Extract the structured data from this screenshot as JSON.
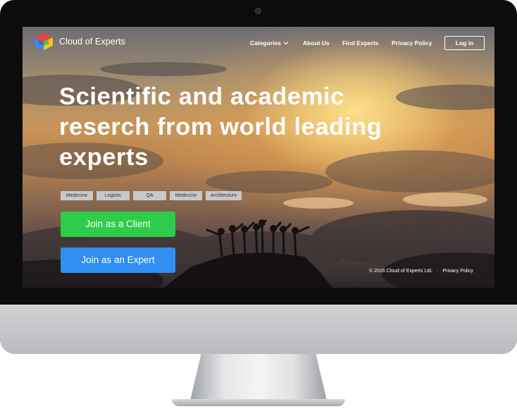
{
  "brand": {
    "name": "Cloud of Experts",
    "logo_icon": "cube-logo-icon",
    "logo_colors": [
      "#2f8ef0",
      "#2ecc4a",
      "#f6c02a",
      "#e8453c",
      "#8e44ad"
    ]
  },
  "nav": {
    "categories": "Categories",
    "about": "About Us",
    "find_experts": "Find Experts",
    "privacy": "Privacy Policy",
    "login": "Log in"
  },
  "hero": {
    "headline": "Scientific and academic reserch from world leading experts",
    "tags": [
      "Medecine",
      "Logistic",
      "QA",
      "Medecine",
      "Architecture"
    ],
    "client_button": "Join as a Client",
    "expert_button": "Join as an Expert"
  },
  "footer": {
    "copyright": "© 2016 Cloud of Experts Ltd.",
    "separator": "·",
    "privacy": "Privacy Policy"
  },
  "colors": {
    "client_button": "#2ecc4a",
    "expert_button": "#2f8ef0"
  }
}
